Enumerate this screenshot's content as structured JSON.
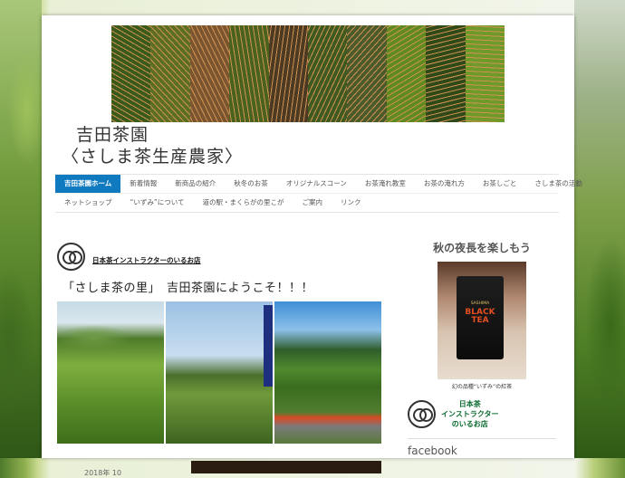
{
  "site": {
    "title_line1": "吉田茶園",
    "title_line2": "〈さしま茶生産農家〉"
  },
  "banner": {
    "tiles": [
      "#3a5a1c",
      "#5b6e23",
      "#7a5530",
      "#49621d",
      "#4c3a22",
      "#3e5a20",
      "#4a5a2a",
      "#5e8a1f",
      "#2f4a18",
      "#6e9a2a"
    ]
  },
  "nav": {
    "row1": [
      "吉田茶園ホーム",
      "新着情報",
      "新商品の紹介",
      "秋冬のお茶",
      "オリジナルスコーン",
      "お茶淹れ教室",
      "お茶の淹れ方",
      "お茶しごと",
      "さしま茶の活動"
    ],
    "row2": [
      "ネットショップ",
      "“いずみ”について",
      "道の駅・まくらがの里こが",
      "ご案内",
      "リンク"
    ],
    "active_index": 0
  },
  "main": {
    "instructor_link": "日本茶インストラクターのいるお店",
    "welcome": "「さしま茶の里」　吉田茶園にようこそ！！！",
    "date_stub": "2018年 10"
  },
  "sidebar": {
    "title": "秋の夜長を楽しもう",
    "bag_brand": "SASHIMA",
    "bag_line1": "BLACK",
    "bag_line2": "TEA",
    "caption": "幻の品種“いずみ”の紅茶",
    "instructor_line1": "日本茶",
    "instructor_line2": "インストラクター",
    "instructor_line3": "のいるお店",
    "facebook": "facebook"
  }
}
